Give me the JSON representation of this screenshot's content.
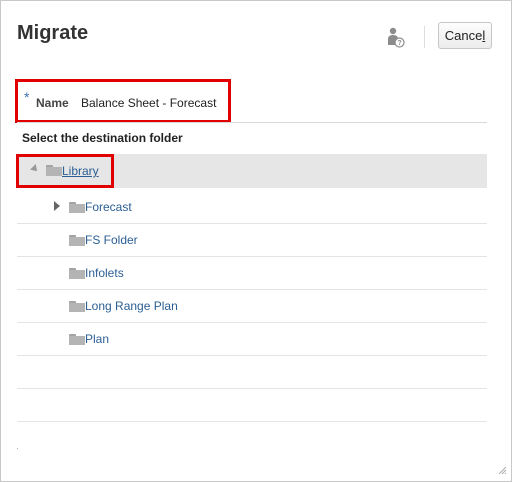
{
  "dialog": {
    "title": "Migrate",
    "cancel_label_prefix": "Cance",
    "cancel_label_mnemonic": "l"
  },
  "name_field": {
    "required_marker": "*",
    "label": "Name",
    "value": "Balance Sheet - Forecast"
  },
  "folder_tree": {
    "heading": "Select the destination folder",
    "root": {
      "label": "Library",
      "expanded": true,
      "selected": true
    },
    "children": [
      {
        "label": "Forecast",
        "expandable": true
      },
      {
        "label": "FS Folder",
        "expandable": false
      },
      {
        "label": "Infolets",
        "expandable": false
      },
      {
        "label": "Long Range Plan",
        "expandable": false
      },
      {
        "label": "Plan",
        "expandable": false
      }
    ]
  },
  "icons": [
    "user-help-icon",
    "collapse-triangle-icon",
    "expand-triangle-icon",
    "folder-icon",
    "resize-grip-icon"
  ],
  "colors": {
    "highlight": "#e00000",
    "link": "#2b5e94",
    "selected_row": "#e6e6e6",
    "required": "#3a73ad"
  }
}
